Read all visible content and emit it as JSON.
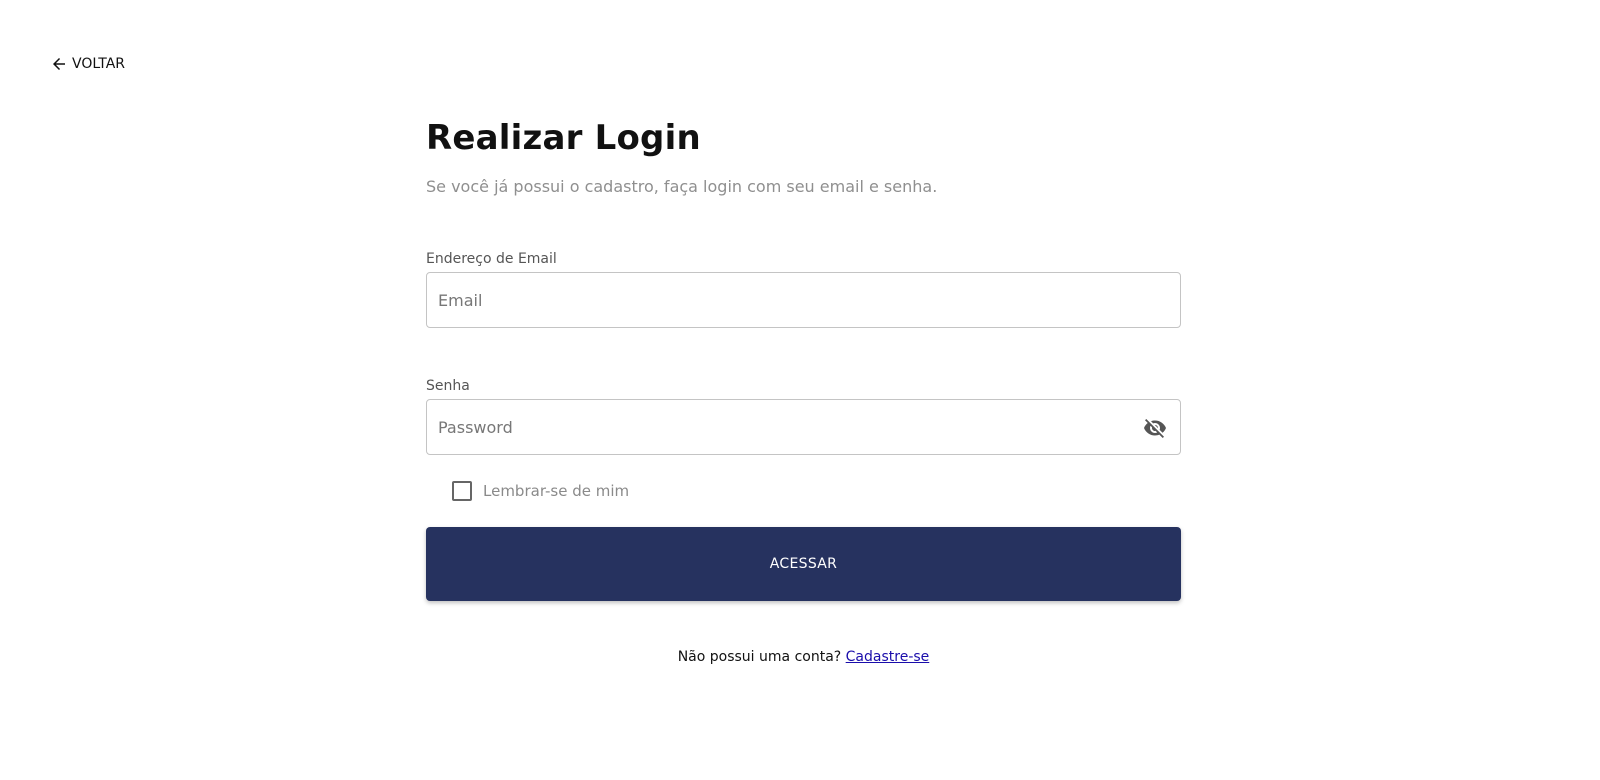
{
  "back": {
    "label": "VOLTAR",
    "icon": "arrow-left-icon"
  },
  "header": {
    "title": "Realizar Login",
    "subtitle": "Se você já possui o cadastro, faça login com seu email e senha."
  },
  "form": {
    "email": {
      "label": "Endereço de Email",
      "placeholder": "Email",
      "value": ""
    },
    "password": {
      "label": "Senha",
      "placeholder": "Password",
      "value": "",
      "toggle_icon": "eye-off-icon"
    },
    "remember": {
      "label": "Lembrar-se de mim",
      "checked": false
    },
    "submit_label": "ACESSAR"
  },
  "signup": {
    "prompt": "Não possui uma conta?",
    "link_label": "Cadastre-se"
  },
  "colors": {
    "primary": "#26325f",
    "link": "#1a0dab",
    "muted_text": "#8f8f8f",
    "input_border": "#c4c4c4"
  }
}
